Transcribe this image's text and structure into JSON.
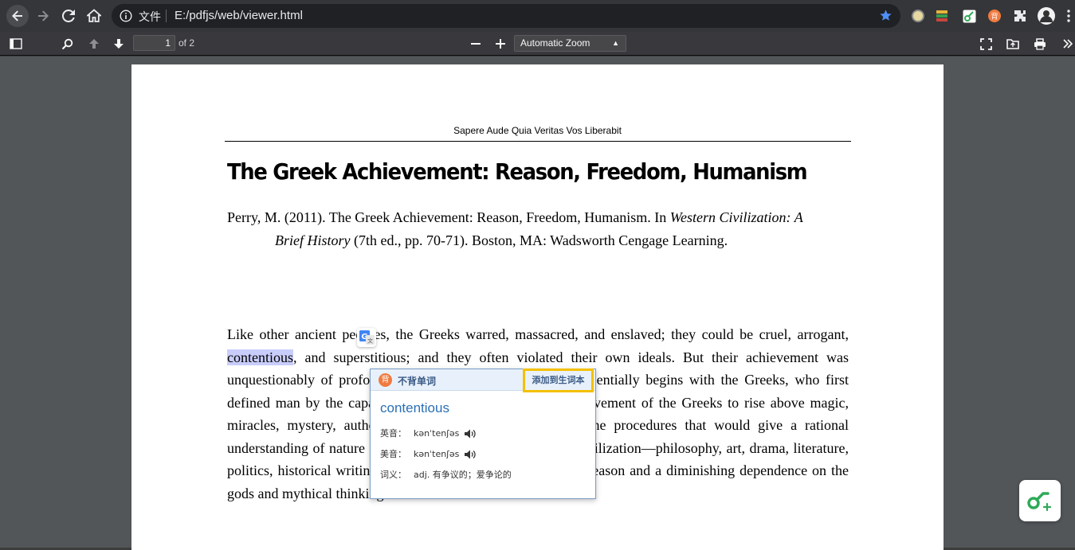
{
  "browser": {
    "omnibox_label": "文件",
    "url": "E:/pdfjs/web/viewer.html"
  },
  "toolbar": {
    "page_current": "1",
    "page_total": "of 2",
    "zoom": "Automatic Zoom"
  },
  "document": {
    "running_head": "Sapere Aude Quia Veritas Vos Liberabit",
    "title": "The Greek Achievement: Reason, Freedom, Humanism",
    "citation_pre": "Perry, M. (2011). The Greek Achievement: Reason, Freedom, Humanism. In ",
    "citation_italic1": "Western Civilization: A",
    "citation_italic2": "Brief History",
    "citation_post": " (7th ed., pp. 70-71). Boston, MA: Wadsworth Cengage Learning.",
    "body_before": "Like other ancient peoples, the Greeks warred, massacred, and enslaved; they could be cruel, arrogant, ",
    "body_highlight": "contentious",
    "body_after": ", and superstitious; and they often violated their own ideals. But their achievement was unquestionably of profound significance. Western thought essentially begins with the Greeks, who first defined man by the capacity to reason. It was the great achievement of the Greeks to rise above magic, miracles, mystery, authority, and custom and to discover the procedures that would give a rational understanding of nature and society. Every aspect of Greek civilization—philosophy, art, drama, literature, politics, historical writing—showed a growing confidence in reason and a diminishing dependence on the gods and mythical thinking."
  },
  "popup": {
    "brand": "不背单词",
    "add_label": "添加到生词本",
    "word": "contentious",
    "uk_label": "英音：",
    "uk_phonetic": "kənˈtenʃəs",
    "us_label": "美音：",
    "us_phonetic": "kənˈtenʃəs",
    "def_label": "词义：",
    "definition": "adj. 有争议的；爱争论的"
  },
  "colors": {
    "accent_blue": "#2a6fb4",
    "highlight": "#c9cdfb",
    "add_border": "#f5c000"
  }
}
